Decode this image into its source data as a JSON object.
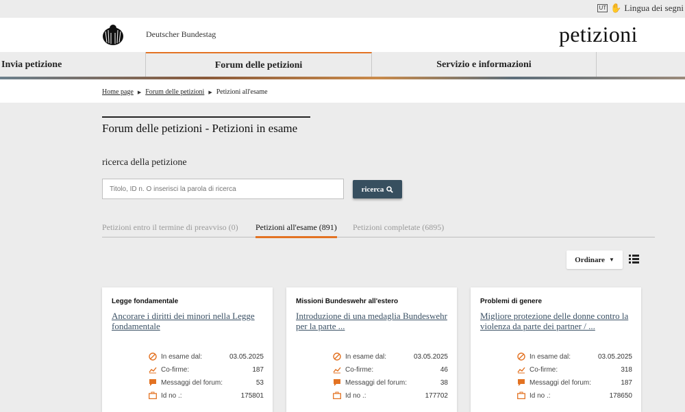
{
  "topbar": {
    "ut_badge": "UT",
    "lang_label": "Lingua dei segni"
  },
  "header": {
    "org": "Deutscher Bundestag",
    "brand": "petizioni"
  },
  "nav": {
    "items": [
      "Invia petizione",
      "Forum delle petizioni",
      "Servizio e informazioni"
    ]
  },
  "breadcrumb": {
    "home": "Home page",
    "forum": "Forum delle petizioni",
    "current": "Petizioni all'esame"
  },
  "page": {
    "title": "Forum delle petizioni - Petizioni in esame",
    "search_label": "ricerca della petizione"
  },
  "search": {
    "placeholder": "Titolo, ID n. O inserisci la parola di ricerca",
    "button": "ricerca"
  },
  "tabs": [
    "Petizioni entro il termine di preavviso (0)",
    "Petizioni all'esame (891)",
    "Petizioni completate (6895)"
  ],
  "sort": {
    "label": "Ordinare"
  },
  "colors": {
    "accent": "#e37222",
    "button_dark": "#374f5f",
    "link": "#3a5064"
  },
  "stat_labels": {
    "since": "In esame dal:",
    "cosign": "Co-firme:",
    "messages": "Messaggi del forum:",
    "id": "Id no .:"
  },
  "cards": [
    {
      "category": "Legge fondamentale",
      "title": "Ancorare i diritti dei minori nella Legge fondamentale",
      "since": "03.05.2025",
      "cosign": "187",
      "messages": "53",
      "id": "175801"
    },
    {
      "category": "Missioni Bundeswehr all'estero",
      "title": "Introduzione di una medaglia Bundeswehr per la parte ...",
      "since": "03.05.2025",
      "cosign": "46",
      "messages": "38",
      "id": "177702"
    },
    {
      "category": "Problemi di genere",
      "title": "Migliore protezione delle donne contro la violenza da parte dei partner / ...",
      "since": "03.05.2025",
      "cosign": "318",
      "messages": "187",
      "id": "178650"
    }
  ]
}
